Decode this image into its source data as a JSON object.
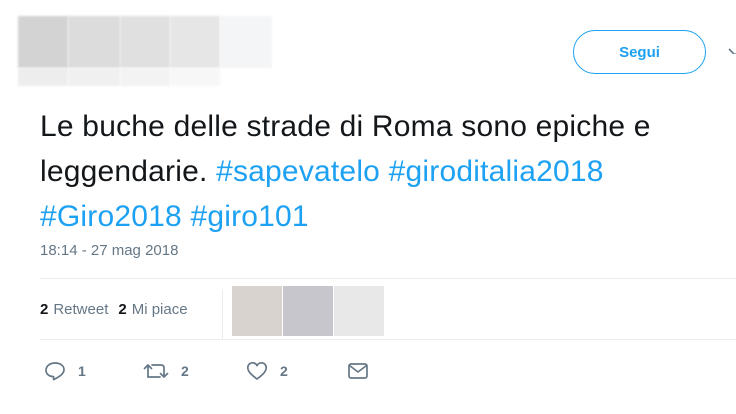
{
  "header": {
    "follow_label": "Segui"
  },
  "tweet": {
    "text_line1": "Le buche delle strade di Roma sono epiche e",
    "text_line2_plain": "leggendarie. ",
    "hashtags": {
      "h1": "#sapevatelo",
      "h2": "#giroditalia2018",
      "h3": "#Giro2018",
      "h4": "#giro101"
    },
    "timestamp": "18:14 - 27 mag 2018"
  },
  "stats": {
    "retweets_count": "2",
    "retweets_label": "Retweet",
    "likes_count": "2",
    "likes_label": "Mi piace"
  },
  "actions": {
    "reply_count": "1",
    "retweet_count": "2",
    "like_count": "2"
  },
  "colors": {
    "accent": "#1da1f2",
    "text": "#14171a",
    "muted": "#657786",
    "divider": "#e6ecf0"
  },
  "icons": {
    "reply": "reply-icon",
    "retweet": "retweet-icon",
    "like": "heart-icon",
    "message": "envelope-icon",
    "menu": "chevron-down-icon"
  }
}
